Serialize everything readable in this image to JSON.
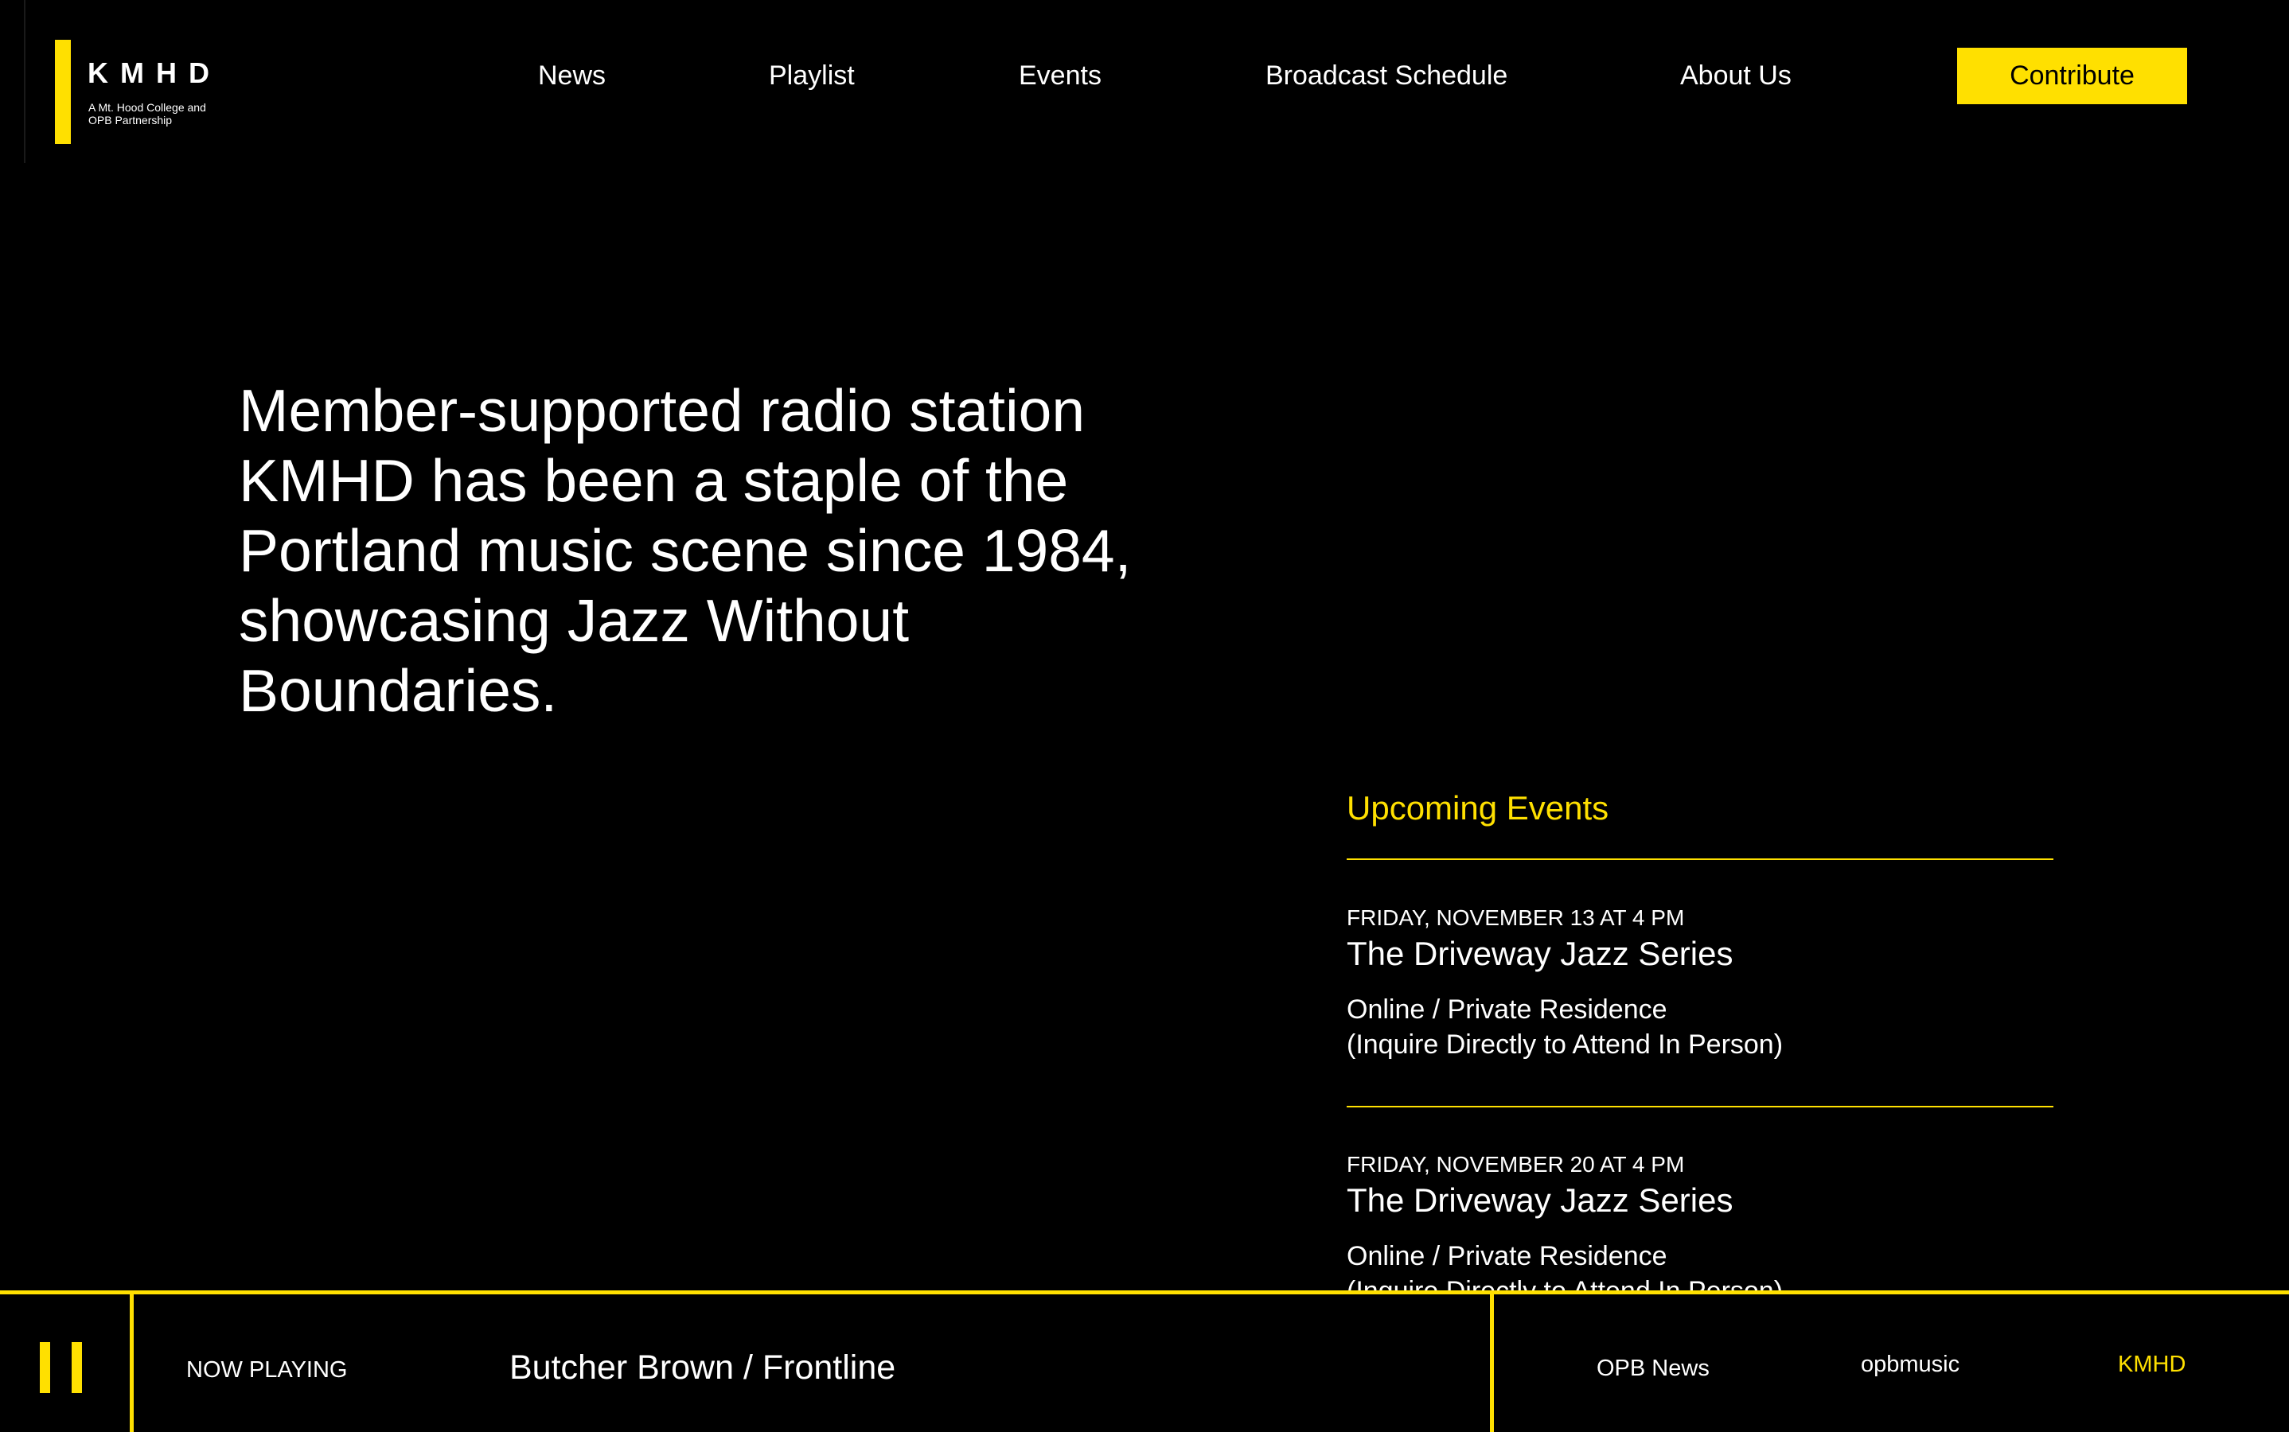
{
  "brand": {
    "name": "KMHD",
    "tagline": "A Mt. Hood College and\nOPB Partnership",
    "accent_color": "#FFE000",
    "background_color": "#000000"
  },
  "nav": {
    "items": [
      {
        "label": "News"
      },
      {
        "label": "Playlist"
      },
      {
        "label": "Events"
      },
      {
        "label": "Broadcast Schedule"
      },
      {
        "label": "About Us"
      }
    ],
    "contribute_label": "Contribute"
  },
  "hero": {
    "text": "Member-supported radio station KMHD has been a staple of the Portland music scene since 1984, showcasing Jazz Without Boundaries."
  },
  "events": {
    "heading": "Upcoming Events",
    "items": [
      {
        "date": "FRIDAY, NOVEMBER 13 AT 4 PM",
        "title": "The Driveway Jazz Series",
        "location_line1": "Online / Private Residence",
        "location_line2": "(Inquire Directly to Attend In Person)"
      },
      {
        "date": "FRIDAY, NOVEMBER 20 AT 4 PM",
        "title": "The Driveway Jazz Series",
        "location_line1": "Online / Private Residence",
        "location_line2": "(Inquire Directly to Attend In Person)"
      }
    ]
  },
  "player": {
    "state_icon": "pause-icon",
    "now_playing_label": "NOW PLAYING",
    "track": "Butcher Brown / Frontline",
    "streams": [
      {
        "label": "OPB News",
        "active": false
      },
      {
        "label": "opbmusic",
        "active": false
      },
      {
        "label": "KMHD",
        "active": true
      }
    ]
  }
}
